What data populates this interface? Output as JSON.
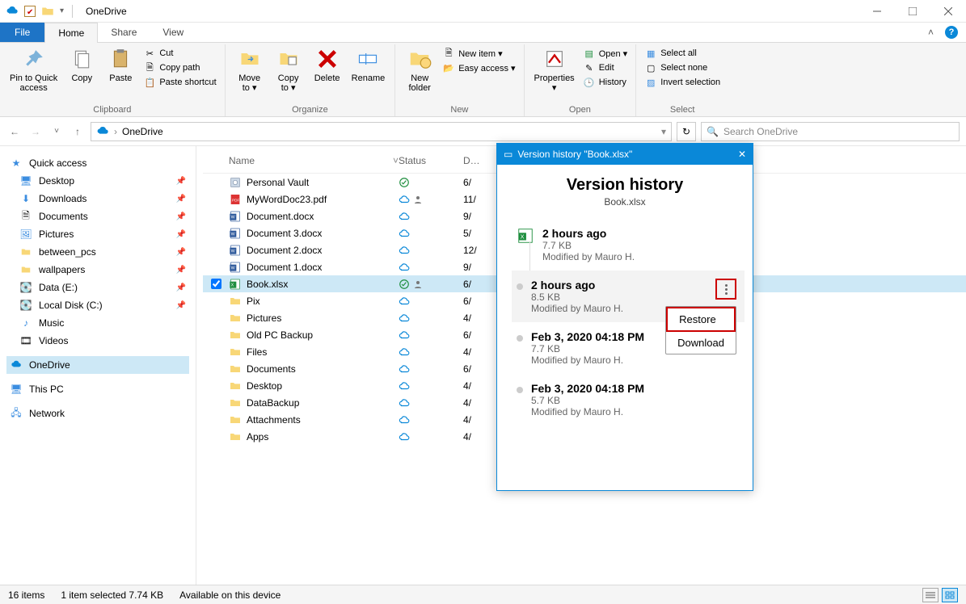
{
  "titlebar": {
    "title": "OneDrive"
  },
  "ribbonTabs": {
    "file": "File",
    "home": "Home",
    "share": "Share",
    "view": "View"
  },
  "ribbon": {
    "clipboard": {
      "label": "Clipboard",
      "pin": "Pin to Quick\naccess",
      "copy": "Copy",
      "paste": "Paste",
      "cut": "Cut",
      "copypath": "Copy path",
      "pasteshortcut": "Paste shortcut"
    },
    "organize": {
      "label": "Organize",
      "moveto": "Move\nto ▾",
      "copyto": "Copy\nto ▾",
      "delete": "Delete",
      "rename": "Rename"
    },
    "new": {
      "label": "New",
      "newfolder": "New\nfolder",
      "newitem": "New item ▾",
      "easyaccess": "Easy access ▾"
    },
    "open": {
      "label": "Open",
      "properties": "Properties\n▾",
      "open": "Open ▾",
      "edit": "Edit",
      "history": "History"
    },
    "select": {
      "label": "Select",
      "selectall": "Select all",
      "selectnone": "Select none",
      "invert": "Invert selection"
    }
  },
  "breadcrumb": {
    "root": "OneDrive",
    "dropdownTail": "▾"
  },
  "search": {
    "placeholder": "Search OneDrive"
  },
  "sidebar": {
    "quickaccess": "Quick access",
    "desktop": "Desktop",
    "downloads": "Downloads",
    "documents": "Documents",
    "pictures": "Pictures",
    "between": "between_pcs",
    "wallpapers": "wallpapers",
    "dataE": "Data (E:)",
    "localC": "Local Disk (C:)",
    "music": "Music",
    "videos": "Videos",
    "onedrive": "OneDrive",
    "thispc": "This PC",
    "network": "Network"
  },
  "columns": {
    "name": "Name",
    "status": "Status",
    "date": "Date"
  },
  "files": [
    {
      "name": "Personal Vault",
      "statusIcons": [
        "check"
      ],
      "date": "6/",
      "icon": "vault"
    },
    {
      "name": "MyWordDoc23.pdf",
      "statusIcons": [
        "cloud",
        "person"
      ],
      "date": "11/",
      "icon": "pdf"
    },
    {
      "name": "Document.docx",
      "statusIcons": [
        "cloud"
      ],
      "date": "9/",
      "icon": "word"
    },
    {
      "name": "Document 3.docx",
      "statusIcons": [
        "cloud"
      ],
      "date": "5/",
      "icon": "word"
    },
    {
      "name": "Document 2.docx",
      "statusIcons": [
        "cloud"
      ],
      "date": "12/",
      "icon": "word"
    },
    {
      "name": "Document 1.docx",
      "statusIcons": [
        "cloud"
      ],
      "date": "9/",
      "icon": "word"
    },
    {
      "name": "Book.xlsx",
      "statusIcons": [
        "check",
        "person"
      ],
      "date": "6/",
      "icon": "excel",
      "selected": true
    },
    {
      "name": "Pix",
      "statusIcons": [
        "cloud"
      ],
      "date": "6/",
      "icon": "folder"
    },
    {
      "name": "Pictures",
      "statusIcons": [
        "cloud"
      ],
      "date": "4/",
      "icon": "folder"
    },
    {
      "name": "Old PC Backup",
      "statusIcons": [
        "cloud"
      ],
      "date": "6/",
      "icon": "folder"
    },
    {
      "name": "Files",
      "statusIcons": [
        "cloud"
      ],
      "date": "4/",
      "icon": "folder"
    },
    {
      "name": "Documents",
      "statusIcons": [
        "cloud"
      ],
      "date": "6/",
      "icon": "folder"
    },
    {
      "name": "Desktop",
      "statusIcons": [
        "cloud"
      ],
      "date": "4/",
      "icon": "folder"
    },
    {
      "name": "DataBackup",
      "statusIcons": [
        "cloud"
      ],
      "date": "4/",
      "icon": "folder"
    },
    {
      "name": "Attachments",
      "statusIcons": [
        "cloud"
      ],
      "date": "4/",
      "icon": "folder"
    },
    {
      "name": "Apps",
      "statusIcons": [
        "cloud"
      ],
      "date": "4/",
      "icon": "folder"
    }
  ],
  "statusbar": {
    "count": "16 items",
    "selection": "1 item selected  7.74 KB",
    "availability": "Available on this device"
  },
  "vh": {
    "dialogTitle": "Version history \"Book.xlsx\"",
    "heading": "Version history",
    "file": "Book.xlsx",
    "items": [
      {
        "time": "2 hours ago",
        "size": "7.7 KB",
        "by": "Modified by Mauro H."
      },
      {
        "time": "2 hours ago",
        "size": "8.5 KB",
        "by": "Modified by Mauro H."
      },
      {
        "time": "Feb  3, 2020 04:18 PM",
        "size": "7.7 KB",
        "by": "Modified by Mauro H."
      },
      {
        "time": "Feb  3, 2020 04:18 PM",
        "size": "5.7 KB",
        "by": "Modified by Mauro H."
      }
    ],
    "menu": {
      "restore": "Restore",
      "download": "Download"
    }
  }
}
